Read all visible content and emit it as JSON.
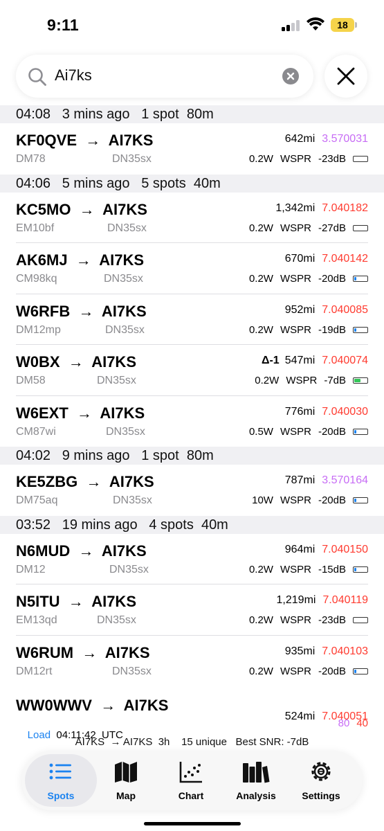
{
  "status_bar": {
    "time": "9:11",
    "battery": "18"
  },
  "search": {
    "query": "Ai7ks"
  },
  "groups": [
    {
      "header": "04:08   3 mins ago   1 spot  80m",
      "spots": [
        {
          "calls": "KF0QVE  →  AI7KS",
          "from_grid": "DM78",
          "to_grid": "DN35sx",
          "distance": "642mi",
          "freq": "3.570031",
          "freq_color": "#c76cf5",
          "power": "0.2W",
          "mode": "WSPR",
          "snr": "-23dB",
          "snr_fill": 0
        }
      ]
    },
    {
      "header": "04:06   5 mins ago   5 spots  40m",
      "spots": [
        {
          "calls": "KC5MO  →  AI7KS",
          "from_grid": "EM10bf",
          "to_grid": "DN35sx",
          "distance": "1,342mi",
          "freq": "7.040182",
          "freq_color": "#ff3b30",
          "power": "0.2W",
          "mode": "WSPR",
          "snr": "-27dB",
          "snr_fill": 0
        },
        {
          "calls": "AK6MJ  →  AI7KS",
          "from_grid": "CM98kq",
          "to_grid": "DN35sx",
          "distance": "670mi",
          "freq": "7.040142",
          "freq_color": "#ff3b30",
          "power": "0.2W",
          "mode": "WSPR",
          "snr": "-20dB",
          "snr_fill": 0.15
        },
        {
          "calls": "W6RFB  →  AI7KS",
          "from_grid": "DM12mp",
          "to_grid": "DN35sx",
          "distance": "952mi",
          "freq": "7.040085",
          "freq_color": "#ff3b30",
          "power": "0.2W",
          "mode": "WSPR",
          "snr": "-19dB",
          "snr_fill": 0.15
        },
        {
          "calls": "W0BX  →  AI7KS",
          "from_grid": "DM58",
          "to_grid": "DN35sx",
          "delta": "Δ-1",
          "distance": "547mi",
          "freq": "7.040074",
          "freq_color": "#ff3b30",
          "power": "0.2W",
          "mode": "WSPR",
          "snr": "-7dB",
          "snr_fill": 0.45,
          "snr_color": "#34c759"
        },
        {
          "calls": "W6EXT  →  AI7KS",
          "from_grid": "CM87wi",
          "to_grid": "DN35sx",
          "distance": "776mi",
          "freq": "7.040030",
          "freq_color": "#ff3b30",
          "power": "0.5W",
          "mode": "WSPR",
          "snr": "-20dB",
          "snr_fill": 0.15
        }
      ]
    },
    {
      "header": "04:02   9 mins ago   1 spot  80m",
      "spots": [
        {
          "calls": "KE5ZBG  →  AI7KS",
          "from_grid": "DM75aq",
          "to_grid": "DN35sx",
          "distance": "787mi",
          "freq": "3.570164",
          "freq_color": "#c76cf5",
          "power": "10W",
          "mode": "WSPR",
          "snr": "-20dB",
          "snr_fill": 0.15
        }
      ]
    },
    {
      "header": "03:52   19 mins ago   4 spots  40m",
      "spots": [
        {
          "calls": "N6MUD  →  AI7KS",
          "from_grid": "DM12",
          "to_grid": "DN35sx",
          "distance": "964mi",
          "freq": "7.040150",
          "freq_color": "#ff3b30",
          "power": "0.2W",
          "mode": "WSPR",
          "snr": "-15dB",
          "snr_fill": 0.15
        },
        {
          "calls": "N5ITU  →  AI7KS",
          "from_grid": "EM13qd",
          "to_grid": "DN35sx",
          "distance": "1,219mi",
          "freq": "7.040119",
          "freq_color": "#ff3b30",
          "power": "0.2W",
          "mode": "WSPR",
          "snr": "-23dB",
          "snr_fill": 0
        },
        {
          "calls": "W6RUM  →  AI7KS",
          "from_grid": "DM12rt",
          "to_grid": "DN35sx",
          "distance": "935mi",
          "freq": "7.040103",
          "freq_color": "#ff3b30",
          "power": "0.2W",
          "mode": "WSPR",
          "snr": "-20dB",
          "snr_fill": 0.15
        }
      ]
    }
  ],
  "last_spot": {
    "calls": "WW0WWV  →  AI7KS",
    "distance": "524mi",
    "freq": "7.040051",
    "load_label": "Load",
    "load_time": "04:11:42  UTC",
    "band_80": "80",
    "band_40": "40"
  },
  "summary": "AI7KS  → AI7KS  3h    15 unique   Best SNR: -7dB",
  "tabs": [
    {
      "label": "Spots",
      "icon": "list-icon",
      "active": true
    },
    {
      "label": "Map",
      "icon": "map-icon"
    },
    {
      "label": "Chart",
      "icon": "scatter-chart-icon"
    },
    {
      "label": "Analysis",
      "icon": "books-icon"
    },
    {
      "label": "Settings",
      "icon": "gear-icon"
    }
  ],
  "colors": {
    "accent": "#1a82f0",
    "band_80m": "#c76cf5",
    "band_40m": "#ff3b30",
    "snr_good": "#34c759"
  }
}
